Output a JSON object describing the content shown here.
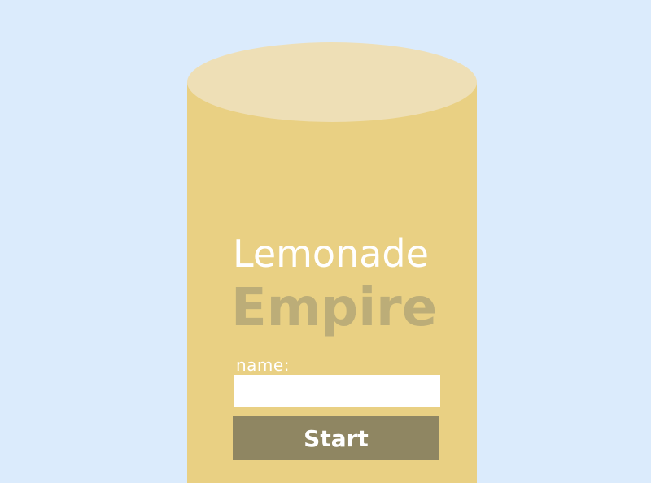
{
  "game": {
    "title_line1": "Lemonade",
    "title_line2": "Empire"
  },
  "form": {
    "name_label": "name:",
    "name_value": "",
    "start_label": "Start"
  },
  "colors": {
    "background": "#dbebfc",
    "glass": "#e9d083",
    "glass_top": "#eedfb6",
    "title_accent": "#bcad78",
    "button": "#8f8662"
  }
}
